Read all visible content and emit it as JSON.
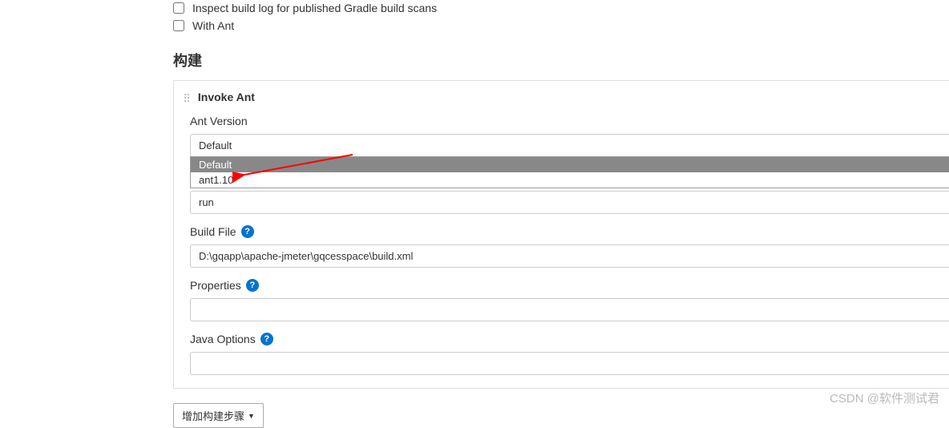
{
  "checkboxes": {
    "inspect_build_log": "Inspect build log for published Gradle build scans",
    "with_ant": "With Ant"
  },
  "section_heading": "构建",
  "invoke_ant": {
    "title": "Invoke Ant",
    "ant_version_label": "Ant Version",
    "ant_version_value": "Default",
    "dropdown_options": [
      "Default",
      "ant1.10"
    ],
    "targets_value": "run",
    "build_file_label": "Build File",
    "build_file_value": "D:\\gqapp\\apache-jmeter\\gqcesspace\\build.xml",
    "properties_label": "Properties",
    "properties_value": "",
    "java_options_label": "Java Options",
    "java_options_value": ""
  },
  "add_step_button": "增加构建步骤",
  "watermark": "CSDN @软件测试君",
  "help_glyph": "?"
}
